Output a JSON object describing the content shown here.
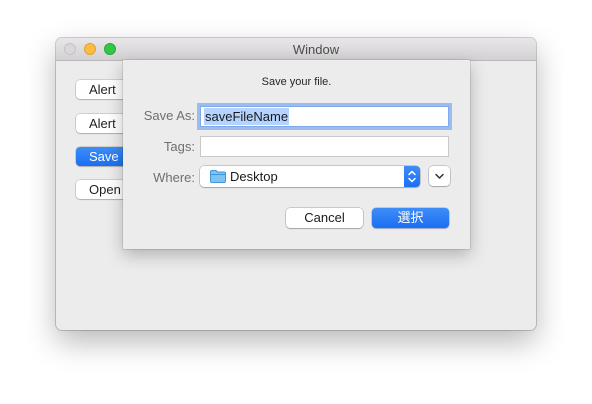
{
  "window": {
    "title": "Window",
    "buttons": [
      {
        "label": "Alert"
      },
      {
        "label": "Alert"
      },
      {
        "label": "Save"
      },
      {
        "label": "Open"
      }
    ]
  },
  "save_sheet": {
    "message": "Save your file.",
    "save_as": {
      "label": "Save As:",
      "value": "saveFileName"
    },
    "tags": {
      "label": "Tags:",
      "value": ""
    },
    "where": {
      "label": "Where:",
      "value": "Desktop",
      "icon": "folder-icon"
    },
    "cancel_label": "Cancel",
    "confirm_label": "選択"
  },
  "colors": {
    "accent": "#1b6ff2",
    "selection": "#b4d3ff",
    "window_bg": "#ececec"
  }
}
